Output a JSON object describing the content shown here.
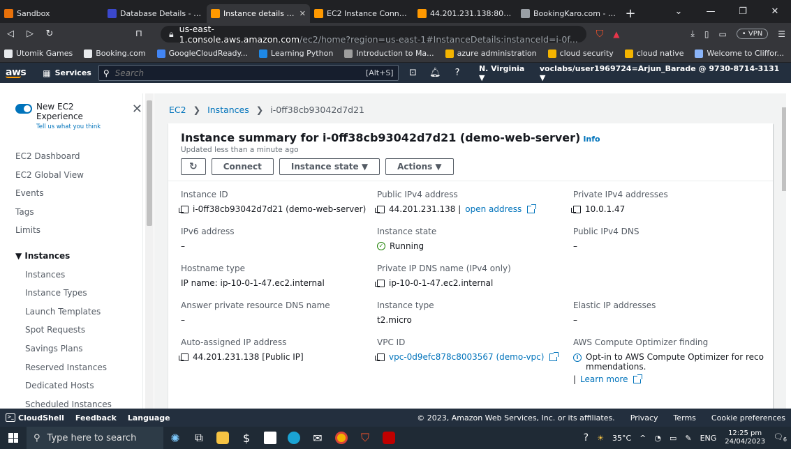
{
  "browser": {
    "tabs": [
      {
        "title": "Sandbox",
        "color": "#e8710a",
        "active": false
      },
      {
        "title": "Database Details - RDS M",
        "color": "#3b48cc",
        "active": false
      },
      {
        "title": "Instance details | EC2",
        "color": "#ff9900",
        "active": true
      },
      {
        "title": "EC2 Instance Connect",
        "color": "#ff9900",
        "active": false
      },
      {
        "title": "44.201.231.138:8080 / m",
        "color": "#ff9900",
        "active": false
      },
      {
        "title": "BookingKaro.com - Hom",
        "color": "#9aa0a6",
        "active": false
      }
    ],
    "url_host": "us-east-1.console.aws.amazon.com",
    "url_rest": "/ec2/home?region=us-east-1#InstanceDetails:instanceId=i-0f...",
    "vpn_label": "• VPN",
    "bookmarks": [
      {
        "label": "Utomik Games",
        "color": "#e8eaed"
      },
      {
        "label": "Booking.com",
        "color": "#e8eaed"
      },
      {
        "label": "GoogleCloudReady...",
        "color": "#4285f4"
      },
      {
        "label": "Learning Python",
        "color": "#1e88e5"
      },
      {
        "label": "Introduction to Ma...",
        "color": "#9e9e9e"
      },
      {
        "label": "azure administration",
        "color": "#f4b400"
      },
      {
        "label": "cloud security",
        "color": "#f4b400"
      },
      {
        "label": "cloud native",
        "color": "#f4b400"
      },
      {
        "label": "Welcome to Cliffor...",
        "color": "#8ab4f8"
      }
    ]
  },
  "aws_nav": {
    "logo": "aws",
    "services": "Services",
    "search_placeholder": "Search",
    "search_hint": "[Alt+S]",
    "region": "N. Virginia ▼",
    "account": "voclabs/user1969724=Arjun_Barade @ 9730-8714-3131 ▼"
  },
  "sidebar": {
    "new_experience": "New EC2 Experience",
    "tell_us": "Tell us what you think",
    "items_top": [
      "EC2 Dashboard",
      "EC2 Global View",
      "Events",
      "Tags",
      "Limits"
    ],
    "section": "▼ Instances",
    "items_instances": [
      "Instances",
      "Instance Types",
      "Launch Templates",
      "Spot Requests",
      "Savings Plans",
      "Reserved Instances",
      "Dedicated Hosts",
      "Scheduled Instances"
    ]
  },
  "breadcrumb": {
    "ec2": "EC2",
    "instances": "Instances",
    "current": "i-0ff38cb93042d7d21"
  },
  "summary": {
    "title": "Instance summary for i-0ff38cb93042d7d21 (demo-web-server)",
    "info": "Info",
    "updated": "Updated less than a minute ago",
    "connect": "Connect",
    "instance_state": "Instance state ▼",
    "actions": "Actions ▼",
    "instance_id_label": "Instance ID",
    "instance_id_value": "i-0ff38cb93042d7d21 (demo-web-server)",
    "public_ipv4_label": "Public IPv4 address",
    "public_ipv4_value": "44.201.231.138 |",
    "open_address": "open address",
    "private_ipv4_label": "Private IPv4 addresses",
    "private_ipv4_value": "10.0.1.47",
    "ipv6_label": "IPv6 address",
    "ipv6_value": "–",
    "instance_state_label": "Instance state",
    "instance_state_value": "Running",
    "public_dns_label": "Public IPv4 DNS",
    "public_dns_value": "–",
    "hostname_type_label": "Hostname type",
    "hostname_type_value": "IP name: ip-10-0-1-47.ec2.internal",
    "private_dns_label": "Private IP DNS name (IPv4 only)",
    "private_dns_value": "ip-10-0-1-47.ec2.internal",
    "answer_dns_label": "Answer private resource DNS name",
    "answer_dns_value": "–",
    "instance_type_label": "Instance type",
    "instance_type_value": "t2.micro",
    "elastic_ip_label": "Elastic IP addresses",
    "elastic_ip_value": "–",
    "auto_ip_label": "Auto-assigned IP address",
    "auto_ip_value": "44.201.231.138 [Public IP]",
    "vpc_label": "VPC ID",
    "vpc_value": "vpc-0d9efc878c8003567 (demo-vpc)",
    "optimizer_label": "AWS Compute Optimizer finding",
    "optimizer_line1": "Opt-in to AWS Compute Optimizer for reco",
    "optimizer_line2": "mmendations.",
    "learn_more": "Learn more"
  },
  "footer": {
    "cloudshell": "CloudShell",
    "feedback": "Feedback",
    "language": "Language",
    "copyright": "© 2023, Amazon Web Services, Inc. or its affiliates.",
    "privacy": "Privacy",
    "terms": "Terms",
    "cookies": "Cookie preferences"
  },
  "taskbar": {
    "search_placeholder": "Type here to search",
    "weather": "35°C",
    "lang": "ENG",
    "time": "12:25 pm",
    "date": "24/04/2023",
    "notifications": "6"
  }
}
